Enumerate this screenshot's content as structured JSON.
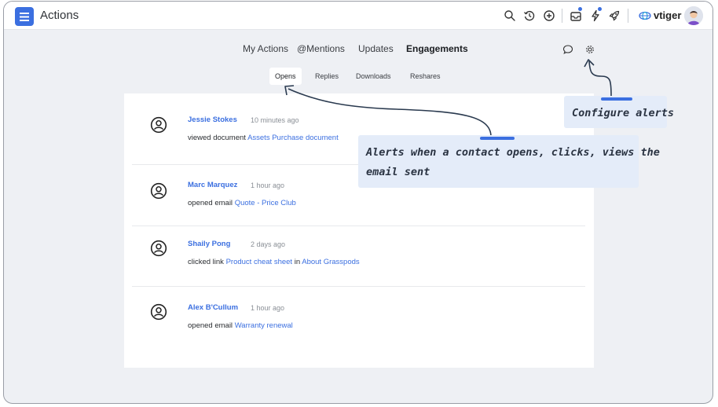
{
  "header": {
    "app_title": "Actions",
    "brand": "vtiger",
    "icons": [
      "menu-icon",
      "search-icon",
      "history-icon",
      "add-icon",
      "inbox-icon",
      "bolt-icon",
      "rocket-icon",
      "vtiger-logo-icon",
      "user-avatar"
    ]
  },
  "main_tabs": [
    {
      "label": "My Actions"
    },
    {
      "label": "@Mentions"
    },
    {
      "label": "Updates"
    },
    {
      "label": "Engagements",
      "active": true
    }
  ],
  "sub_tabs": [
    {
      "label": "Opens",
      "active": true
    },
    {
      "label": "Replies"
    },
    {
      "label": "Downloads"
    },
    {
      "label": "Reshares"
    }
  ],
  "engagements": [
    {
      "name": "Jessie Stokes",
      "time": "10 minutes ago",
      "action": "viewed document",
      "link": "Assets Purchase document",
      "connector": "",
      "link2": ""
    },
    {
      "name": "Marc Marquez",
      "time": "1 hour ago",
      "action": "opened email",
      "link": "Quote - Price Club",
      "connector": "",
      "link2": ""
    },
    {
      "name": "Shaily Pong",
      "time": "2 days ago",
      "action": "clicked link",
      "link": "Product cheat sheet",
      "connector": "in",
      "link2": "About Grasspods"
    },
    {
      "name": "Alex B'Cullum",
      "time": "1 hour ago",
      "action": "opened email",
      "link": "Warranty renewal",
      "connector": "",
      "link2": ""
    }
  ],
  "callouts": {
    "configure": "Configure alerts",
    "alerts_line1": "Alerts when a contact opens, clicks, views the",
    "alerts_line2": "email sent"
  },
  "colors": {
    "accent": "#3b6fe0",
    "background": "#eef0f4",
    "callout_bg": "#e4ecf9",
    "arrow": "#2a3a4f"
  }
}
